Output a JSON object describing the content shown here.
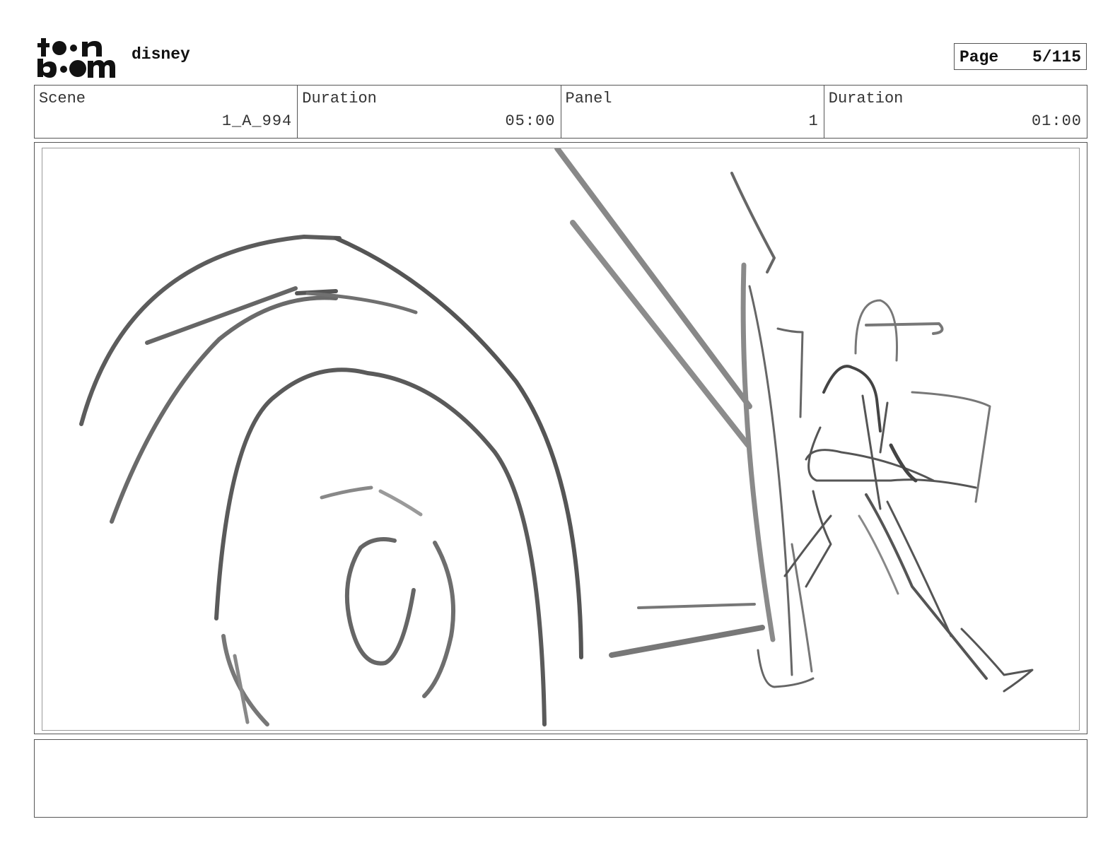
{
  "header": {
    "logo_text": "toon boom",
    "project_name": "disney",
    "page_label": "Page",
    "page_value": "5/115"
  },
  "info": {
    "scene_label": "Scene",
    "scene_value": "1_A_994",
    "scene_duration_label": "Duration",
    "scene_duration_value": "05:00",
    "panel_label": "Panel",
    "panel_value": "1",
    "panel_duration_label": "Duration",
    "panel_duration_value": "01:00"
  },
  "notes": {
    "text": ""
  },
  "colors": {
    "border": "#555555",
    "sketch_dark": "#555555",
    "sketch_light": "#8a8a8a"
  }
}
